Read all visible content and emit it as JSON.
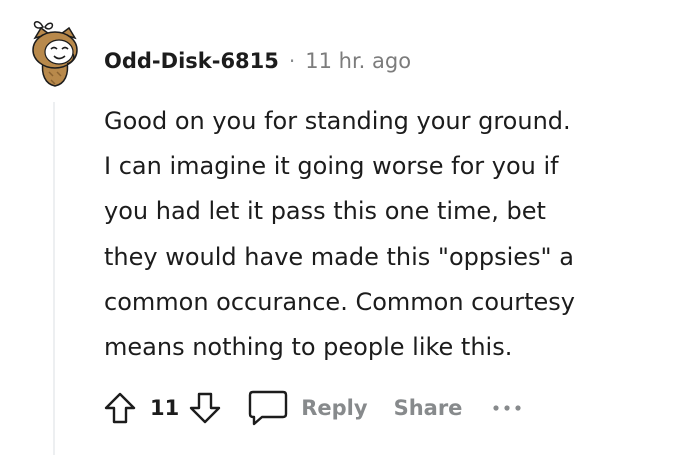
{
  "comment": {
    "username": "Odd-Disk-6815",
    "separator": "·",
    "timestamp": "11 hr. ago",
    "body_lines": [
      "Good on you for standing your ground.",
      "I can imagine it going worse for you if",
      "you had let it pass this one time, bet",
      "they would have made this \"oppsies\" a",
      "common occurance. Common courtesy",
      "means nothing to people like this."
    ]
  },
  "actions": {
    "score": "11",
    "reply_label": "Reply",
    "share_label": "Share",
    "upvote_icon": "arrow-up-outline-icon",
    "downvote_icon": "arrow-down-outline-icon",
    "reply_icon": "speech-bubble-icon",
    "more_icon": "ellipsis-icon"
  },
  "colors": {
    "text_primary": "#1c1c1c",
    "text_muted": "#878a8c",
    "thread_line": "#edeff1",
    "avatar_fur": "#b8894b",
    "avatar_fur_dark": "#8a6230"
  }
}
